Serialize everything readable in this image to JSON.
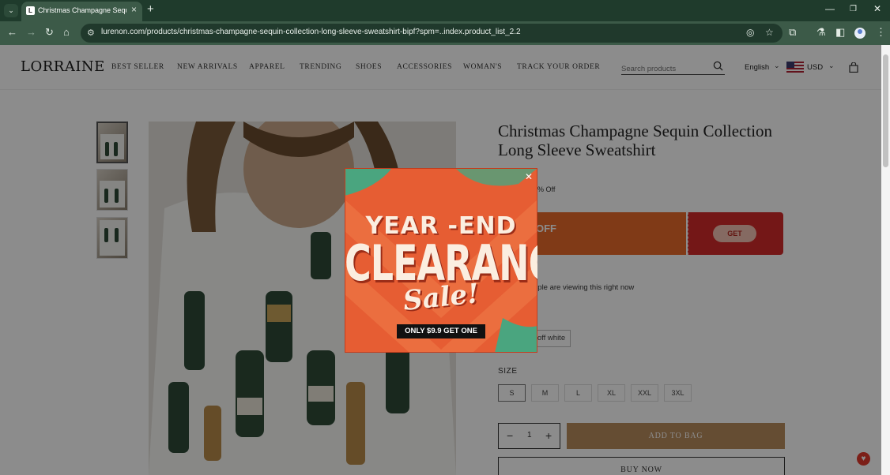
{
  "browser": {
    "tab_title": "Christmas Champagne Sequin L",
    "url": "lurenon.com/products/christmas-champagne-sequin-collection-long-sleeve-sweatshirt-bipf?spm=..index.product_list_2.2"
  },
  "header": {
    "logo": "LORRAINE",
    "nav": [
      "BEST SELLER",
      "NEW ARRIVALS",
      "APPAREL",
      "TRENDING",
      "SHOES",
      "ACCESSORIES",
      "WOMAN'S",
      "TRACK YOUR ORDER"
    ],
    "search_placeholder": "Search products",
    "language": "English",
    "currency": "USD"
  },
  "product": {
    "title": "Christmas Champagne Sequin Collection Long Sleeve Sweatshirt",
    "discount_note": "5% Off",
    "coupon_text": "OFF",
    "get_label": "GET",
    "viewing_text": "ople are viewing this right now",
    "color_value": "off white",
    "size_label": "SIZE",
    "sizes": [
      "S",
      "M",
      "L",
      "XL",
      "XXL",
      "3XL"
    ],
    "selected_size": "S",
    "quantity": "1",
    "add_to_bag": "ADD TO BAG",
    "buy_now": "BUY NOW"
  },
  "popup": {
    "line1": "YEAR -END",
    "line2": "CLEARANCE",
    "line3": "Sale!",
    "cta": "ONLY $9.9 GET ONE"
  },
  "colors": {
    "browser_frame": "#1f3b2c",
    "add_to_bag_bg": "#b98c5e",
    "coupon_orange": "#ea6b2b",
    "coupon_red": "#d42a2a",
    "popup_bg": "#e65d33"
  }
}
